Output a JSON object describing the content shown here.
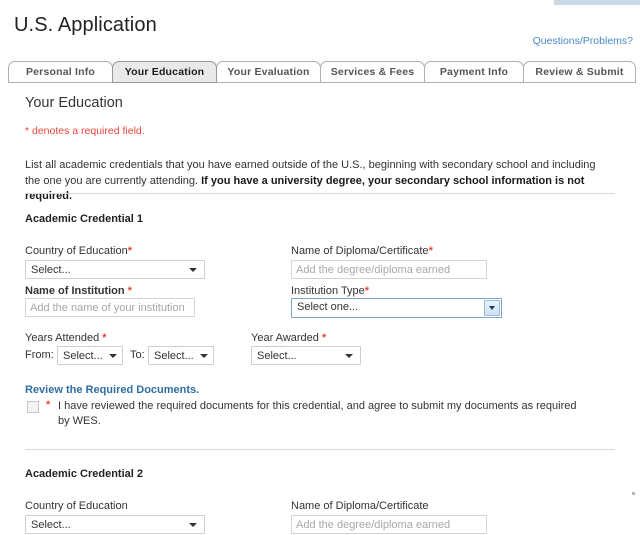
{
  "header": {
    "app_title": "U.S. Application",
    "help_link": "Questions/Problems?"
  },
  "tabs": [
    {
      "label": "Personal Info",
      "active": false
    },
    {
      "label": "Your Education",
      "active": true
    },
    {
      "label": "Your Evaluation",
      "active": false
    },
    {
      "label": "Services & Fees",
      "active": false
    },
    {
      "label": "Payment Info",
      "active": false
    },
    {
      "label": "Review & Submit",
      "active": false
    }
  ],
  "page": {
    "section_title": "Your Education",
    "required_note": "* denotes a required field.",
    "intro_part1": "List all academic credentials that you have earned outside of the U.S., beginning with secondary school and including the one you are currently attending. ",
    "intro_bold": "If you have a university degree, your secondary school information is not required."
  },
  "credential1": {
    "heading": "Academic Credential 1",
    "country_label": "Country of Education",
    "country_value": "Select...",
    "diploma_label": "Name of Diploma/Certificate",
    "diploma_placeholder": "Add the degree/diploma earned",
    "diploma_value": "",
    "institution_label": "Name of Institution ",
    "institution_placeholder": "Add the name of your institution",
    "institution_value": "",
    "institution_type_label": "Institution Type",
    "institution_type_value": "Select one...",
    "years_attended_label": "Years Attended ",
    "from_label": "From:",
    "from_value": "Select...",
    "to_label": "To:",
    "to_value": "Select...",
    "year_awarded_label": "Year Awarded ",
    "year_awarded_value": "Select...",
    "documents_link": "Review the Required Documents.",
    "consent_star": "*",
    "consent_text": "I have reviewed the required documents for this credential, and agree to submit my documents as required by WES.",
    "required_marker": "*"
  },
  "credential2": {
    "heading": "Academic Credential 2",
    "country_label": "Country of Education",
    "country_value": "Select...",
    "diploma_label": "Name of Diploma/Certificate",
    "diploma_placeholder": "Add the degree/diploma earned",
    "diploma_value": ""
  },
  "colors": {
    "required_red": "#e8463c",
    "link_blue": "#4a89c8",
    "doc_link_blue": "#2f6ea5",
    "active_tab_bg": "#e9e9e9",
    "top_band": "#cbd8e6"
  }
}
